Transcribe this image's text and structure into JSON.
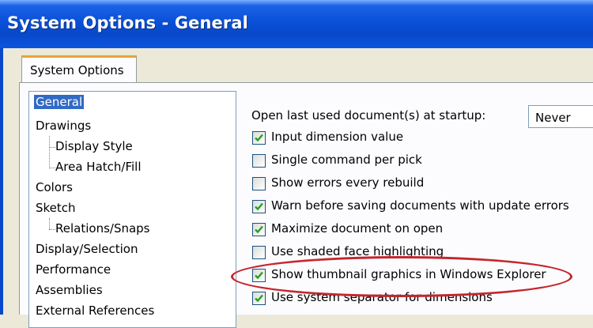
{
  "window": {
    "title": "System Options - General"
  },
  "tabs": [
    {
      "label": "System Options"
    }
  ],
  "tree": {
    "items": [
      {
        "label": "General",
        "selected": true
      },
      {
        "label": "Drawings"
      },
      {
        "label": "Display Style"
      },
      {
        "label": "Area Hatch/Fill"
      },
      {
        "label": "Colors"
      },
      {
        "label": "Sketch"
      },
      {
        "label": "Relations/Snaps"
      },
      {
        "label": "Display/Selection"
      },
      {
        "label": "Performance"
      },
      {
        "label": "Assemblies"
      },
      {
        "label": "External References"
      }
    ]
  },
  "options": {
    "startup_label": "Open last used document(s) at startup:",
    "startup_value": "Never",
    "checkboxes": [
      {
        "label": "Input dimension value",
        "checked": true
      },
      {
        "label": "Single command per pick",
        "checked": false
      },
      {
        "label": "Show errors every rebuild",
        "checked": false
      },
      {
        "label": "Warn before saving documents with update errors",
        "checked": true
      },
      {
        "label": "Maximize document on open",
        "checked": true
      },
      {
        "label": "Use shaded face highlighting",
        "checked": false
      },
      {
        "label": "Show thumbnail graphics in Windows Explorer",
        "checked": true
      },
      {
        "label": "Use system separator for dimensions",
        "checked": true
      }
    ]
  },
  "colors": {
    "title_bar": "#0a50d8",
    "tab_accent": "#e8a33a",
    "selection": "#316ac5",
    "highlight_ellipse": "#c4262e",
    "checkmark": "#21a121"
  }
}
